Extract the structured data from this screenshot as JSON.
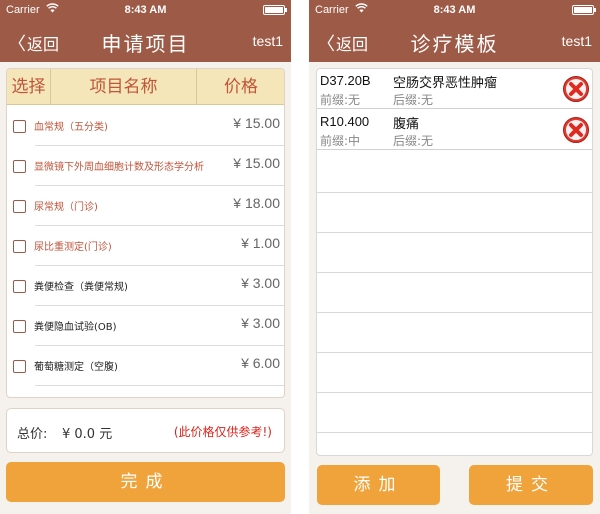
{
  "status": {
    "carrier": "Carrier",
    "wifi_icon": "wifi-icon",
    "time": "8:43 AM"
  },
  "left": {
    "nav": {
      "back_chevron": "〈",
      "back_label": "返回",
      "title": "申请项目",
      "user": "test1"
    },
    "table": {
      "headers": [
        "选择",
        "项目名称",
        "价格"
      ],
      "rows": [
        {
          "name": "血常规（五分类)",
          "price": "¥ 15.00",
          "color": "#c0553a"
        },
        {
          "name": "显微镜下外周血细胞计数及形态学分析",
          "price": "¥ 15.00",
          "color": "#c0553a"
        },
        {
          "name": "尿常规（门诊)",
          "price": "¥ 18.00",
          "color": "#c0553a"
        },
        {
          "name": "尿比重测定(门诊)",
          "price": "¥ 1.00",
          "color": "#c0553a"
        },
        {
          "name": "粪便检查（粪便常规)",
          "price": "¥ 3.00",
          "color": "#222222"
        },
        {
          "name": "粪便隐血试验(OB)",
          "price": "¥ 3.00",
          "color": "#222222"
        },
        {
          "name": "葡萄糖测定（空腹)",
          "price": "¥ 6.00",
          "color": "#222222"
        }
      ]
    },
    "total": {
      "label": "总价:",
      "value": "¥ 0.0 元",
      "note": "(此价格仅供参考!)"
    },
    "done_button": "完成"
  },
  "right": {
    "nav": {
      "back_chevron": "〈",
      "back_label": "返回",
      "title": "诊疗模板",
      "user": "test1"
    },
    "items": [
      {
        "code": "D37.20B",
        "name": "空肠交界恶性肿瘤",
        "prefix": "前缀:无",
        "suffix": "后缀:无",
        "delete_icon": "delete-icon"
      },
      {
        "code": "R10.400",
        "name": "腹痛",
        "prefix": "前缀:中",
        "suffix": "后缀:无",
        "delete_icon": "delete-icon"
      }
    ],
    "add_button": "添加",
    "submit_button": "提交"
  },
  "colors": {
    "navbar": "#9d5a46",
    "button": "#f0a33a",
    "header_bg": "#f4e6b8",
    "header_text": "#c0553a",
    "note": "#d8241c"
  }
}
